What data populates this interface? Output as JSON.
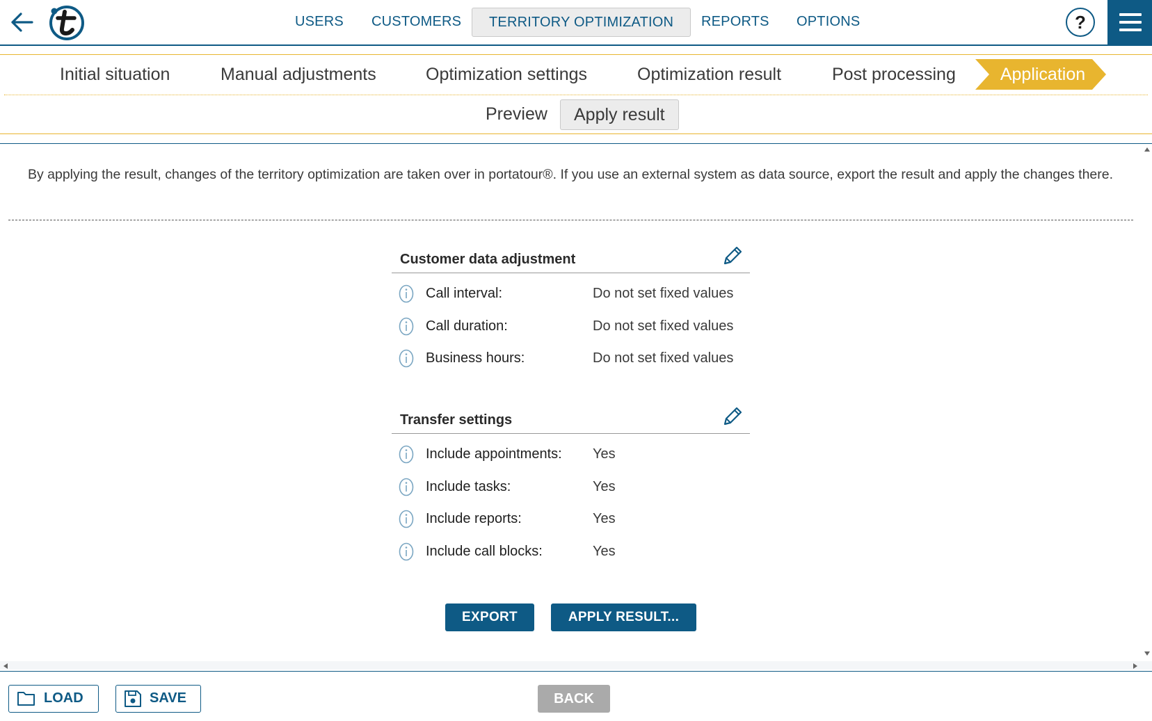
{
  "header": {
    "nav": [
      {
        "label": "USERS"
      },
      {
        "label": "CUSTOMERS"
      },
      {
        "label": "TERRITORY OPTIMIZATION"
      },
      {
        "label": "REPORTS"
      },
      {
        "label": "OPTIONS"
      }
    ],
    "active_nav": "TERRITORY OPTIMIZATION",
    "help_label": "?"
  },
  "steps": {
    "items": [
      {
        "label": "Initial situation"
      },
      {
        "label": "Manual adjustments"
      },
      {
        "label": "Optimization settings"
      },
      {
        "label": "Optimization result"
      },
      {
        "label": "Post processing"
      },
      {
        "label": "Application"
      }
    ],
    "active": "Application",
    "subtabs": [
      {
        "label": "Preview"
      },
      {
        "label": "Apply result"
      }
    ],
    "active_subtab": "Apply result"
  },
  "main": {
    "intro": "By applying the result, changes of the territory optimization are taken over in portatour®. If you use an external system as data source, export the result and apply the changes there.",
    "customer_data": {
      "title": "Customer data adjustment",
      "rows": [
        {
          "label": "Call interval:",
          "value": "Do not set fixed values"
        },
        {
          "label": "Call duration:",
          "value": "Do not set fixed values"
        },
        {
          "label": "Business hours:",
          "value": "Do not set fixed values"
        }
      ]
    },
    "transfer": {
      "title": "Transfer settings",
      "rows": [
        {
          "label": "Include appointments:",
          "value": "Yes"
        },
        {
          "label": "Include tasks:",
          "value": "Yes"
        },
        {
          "label": "Include reports:",
          "value": "Yes"
        },
        {
          "label": "Include call blocks:",
          "value": "Yes"
        }
      ]
    },
    "export_label": "EXPORT",
    "apply_label": "APPLY RESULT..."
  },
  "footer": {
    "load_label": "LOAD",
    "save_label": "SAVE",
    "back_label": "BACK"
  },
  "colors": {
    "brand": "#0e5a85",
    "step_active": "#e8b52f",
    "disabled": "#aaaaaa"
  },
  "icons": [
    "back-arrow-icon",
    "portatour-logo",
    "help-icon",
    "hamburger-menu-icon",
    "pencil-icon",
    "info-icon",
    "folder-icon",
    "floppy-disk-icon"
  ]
}
